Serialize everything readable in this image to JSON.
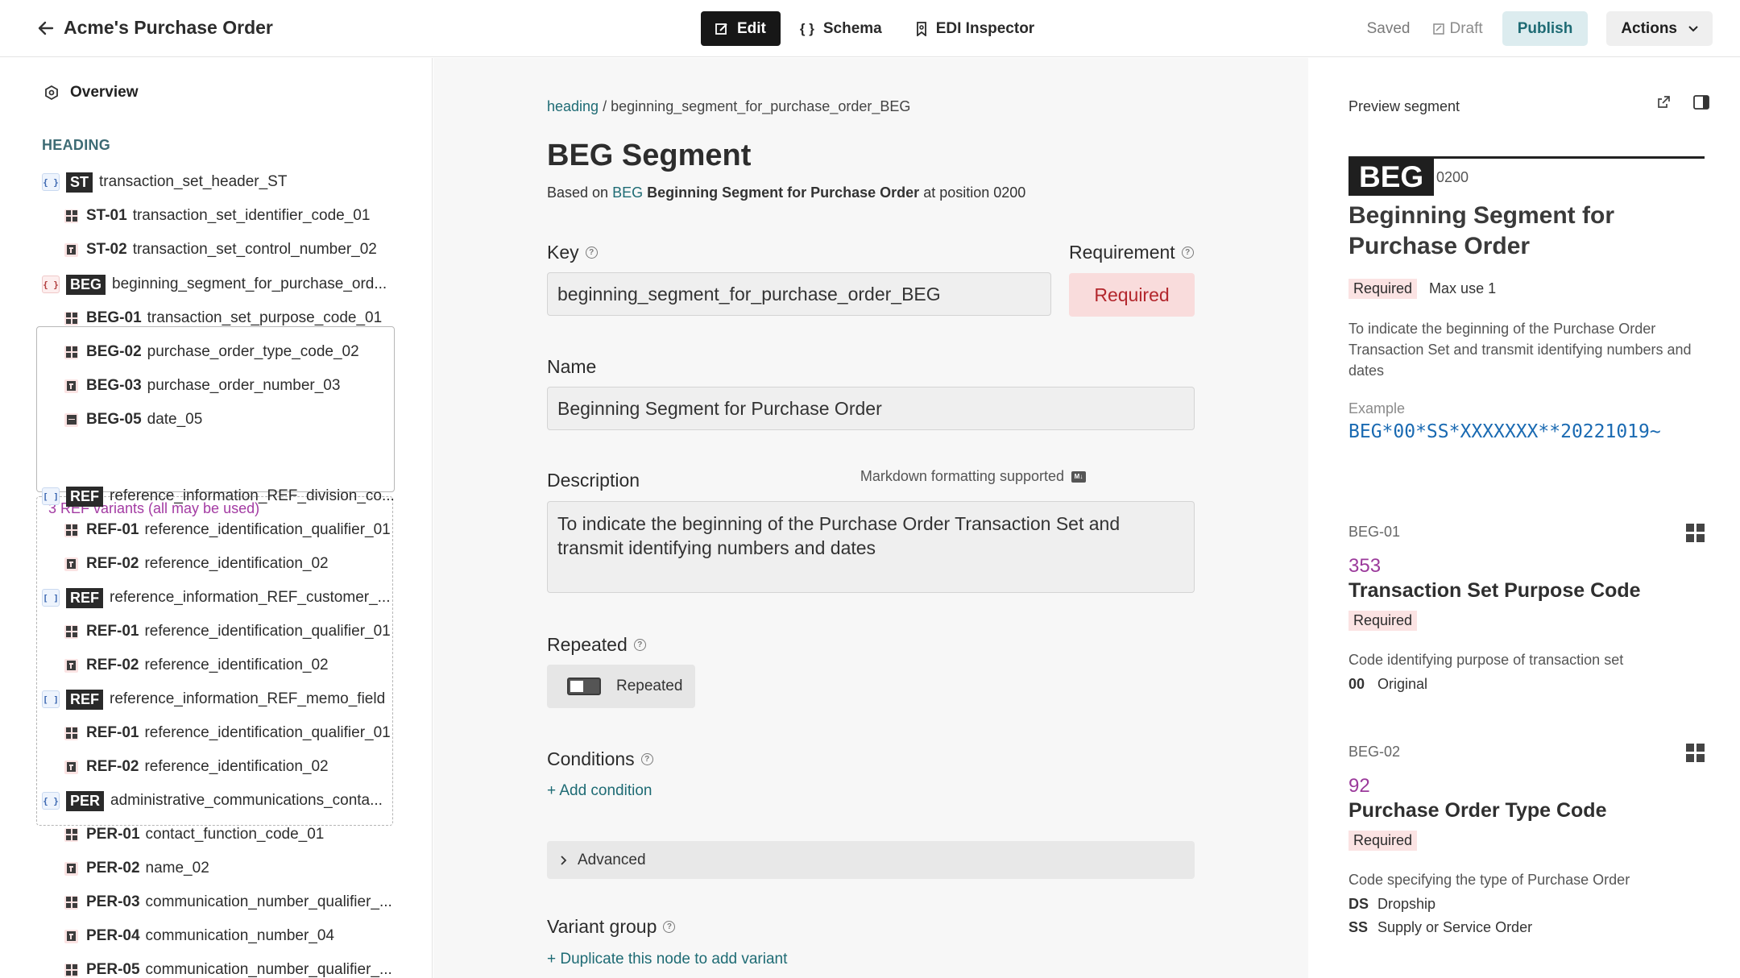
{
  "header": {
    "title": "Acme's Purchase Order",
    "tabs": [
      {
        "label": "Edit",
        "icon": "edit-icon"
      },
      {
        "label": "Schema",
        "icon": "braces-icon"
      },
      {
        "label": "EDI Inspector",
        "icon": "inspect-icon"
      }
    ],
    "status": "Saved",
    "draft": "Draft",
    "publish": "Publish",
    "actions": "Actions"
  },
  "sidebar": {
    "overview": "Overview",
    "section": "HEADING",
    "ref_note": "3 REF variants (all may be used)",
    "rows": [
      {
        "kind": "segment",
        "tag": "ST",
        "label": "transaction_set_header_ST"
      },
      {
        "kind": "element",
        "icon": "grid",
        "id": "ST-01",
        "label": "transaction_set_identifier_code_01"
      },
      {
        "kind": "element",
        "icon": "text",
        "id": "ST-02",
        "label": "transaction_set_control_number_02"
      },
      {
        "kind": "segment",
        "tag": "BEG",
        "label": "beginning_segment_for_purchase_ord...",
        "selected": true
      },
      {
        "kind": "element",
        "icon": "grid",
        "id": "BEG-01",
        "label": "transaction_set_purpose_code_01"
      },
      {
        "kind": "element",
        "icon": "grid",
        "id": "BEG-02",
        "label": "purchase_order_type_code_02"
      },
      {
        "kind": "element",
        "icon": "text",
        "id": "BEG-03",
        "label": "purchase_order_number_03"
      },
      {
        "kind": "element",
        "icon": "date",
        "id": "BEG-05",
        "label": "date_05"
      },
      {
        "kind": "loop",
        "tag": "REF",
        "label": "reference_information_REF_division_co..."
      },
      {
        "kind": "element",
        "icon": "grid",
        "id": "REF-01",
        "label": "reference_identification_qualifier_01"
      },
      {
        "kind": "element",
        "icon": "text",
        "id": "REF-02",
        "label": "reference_identification_02"
      },
      {
        "kind": "loop",
        "tag": "REF",
        "label": "reference_information_REF_customer_..."
      },
      {
        "kind": "element",
        "icon": "grid",
        "id": "REF-01",
        "label": "reference_identification_qualifier_01"
      },
      {
        "kind": "element",
        "icon": "text",
        "id": "REF-02",
        "label": "reference_identification_02"
      },
      {
        "kind": "loop",
        "tag": "REF",
        "label": "reference_information_REF_memo_field"
      },
      {
        "kind": "element",
        "icon": "grid",
        "id": "REF-01",
        "label": "reference_identification_qualifier_01"
      },
      {
        "kind": "element",
        "icon": "text",
        "id": "REF-02",
        "label": "reference_identification_02"
      },
      {
        "kind": "segment",
        "tag": "PER",
        "label": "administrative_communications_conta..."
      },
      {
        "kind": "element",
        "icon": "grid",
        "id": "PER-01",
        "label": "contact_function_code_01"
      },
      {
        "kind": "element",
        "icon": "text",
        "id": "PER-02",
        "label": "name_02"
      },
      {
        "kind": "element",
        "icon": "grid",
        "id": "PER-03",
        "label": "communication_number_qualifier_..."
      },
      {
        "kind": "element",
        "icon": "text",
        "id": "PER-04",
        "label": "communication_number_04"
      },
      {
        "kind": "element",
        "icon": "grid",
        "id": "PER-05",
        "label": "communication_number_qualifier_..."
      }
    ]
  },
  "main": {
    "breadcrumb_link": "heading",
    "breadcrumb_sep": "/",
    "breadcrumb_current": "beginning_segment_for_purchase_order_BEG",
    "title": "BEG Segment",
    "based_prefix": "Based on",
    "based_code": "BEG",
    "based_name": "Beginning Segment for Purchase Order",
    "based_suffix": "at position 0200",
    "key_label": "Key",
    "key_value": "beginning_segment_for_purchase_order_BEG",
    "requirement_label": "Requirement",
    "requirement_value": "Required",
    "name_label": "Name",
    "name_value": "Beginning Segment for Purchase Order",
    "description_label": "Description",
    "markdown_note": "Markdown formatting supported",
    "description_value": "To indicate the beginning of the Purchase Order Transaction Set and transmit identifying numbers and dates",
    "repeated_label": "Repeated",
    "repeated_toggle": "Repeated",
    "conditions_label": "Conditions",
    "add_condition": "+ Add condition",
    "advanced": "Advanced",
    "variant_label": "Variant group",
    "duplicate_link": "+ Duplicate this node to add variant"
  },
  "preview": {
    "label": "Preview segment",
    "tag": "BEG",
    "position": "0200",
    "name": "Beginning Segment for Purchase Order",
    "required": "Required",
    "max_use": "Max use 1",
    "description": "To indicate the beginning of the Purchase Order Transaction Set and transmit identifying numbers and dates",
    "example_label": "Example",
    "example": "BEG*00*SS*XXXXXXX**20221019~",
    "elements": [
      {
        "code": "BEG-01",
        "number": "353",
        "title": "Transaction Set Purpose Code",
        "required": "Required",
        "description": "Code identifying purpose of transaction set",
        "options": [
          {
            "code": "00",
            "label": "Original"
          }
        ]
      },
      {
        "code": "BEG-02",
        "number": "92",
        "title": "Purchase Order Type Code",
        "required": "Required",
        "description": "Code specifying the type of Purchase Order",
        "options": [
          {
            "code": "DS",
            "label": "Dropship"
          },
          {
            "code": "SS",
            "label": "Supply or Service Order"
          }
        ]
      }
    ]
  }
}
